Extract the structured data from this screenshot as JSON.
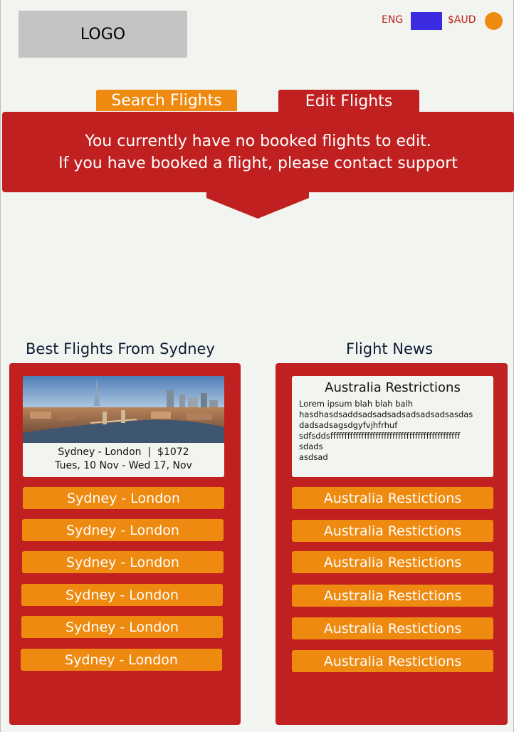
{
  "header": {
    "logo_text": "LOGO",
    "language": "ENG",
    "currency": "$AUD",
    "colors": {
      "accent_red": "#c0201f",
      "accent_orange": "#ef8a10",
      "language_swatch": "#3b2be0"
    }
  },
  "tabs": {
    "search_label": "Search Flights",
    "edit_label": "Edit Flights"
  },
  "banner": {
    "line1": "You currently have no booked flights to edit.",
    "line2": "If you have booked a flight, please contact support"
  },
  "best_flights": {
    "title": "Best Flights From Sydney",
    "featured": {
      "route_price": "Sydney - London  |  $1072",
      "dates": "Tues, 10 Nov - Wed 17, Nov",
      "image_alt": "london-skyline-image"
    },
    "items": [
      {
        "label": "Sydney - London"
      },
      {
        "label": "Sydney - London"
      },
      {
        "label": "Sydney - London"
      },
      {
        "label": "Sydney - London"
      },
      {
        "label": "Sydney - London"
      },
      {
        "label": "Sydney - London"
      }
    ]
  },
  "news": {
    "title": "Flight News",
    "featured": {
      "title": "Australia Restrictions",
      "body": "Lorem ipsum blah blah balh\nhasdhasdsaddsadsadsadsadsadsadsasdas\ndadsadsagsdgyfvjhfrhuf\nsdfsddsffffffffffffffffffffffffffffffffffffffffffffff\nsdads\nasdsad"
    },
    "items": [
      {
        "label": "Australia Restictions"
      },
      {
        "label": "Australia Restictions"
      },
      {
        "label": "Australia Restictions"
      },
      {
        "label": "Australia Restictions"
      },
      {
        "label": "Australia Restictions"
      },
      {
        "label": "Australia Restictions"
      }
    ]
  }
}
